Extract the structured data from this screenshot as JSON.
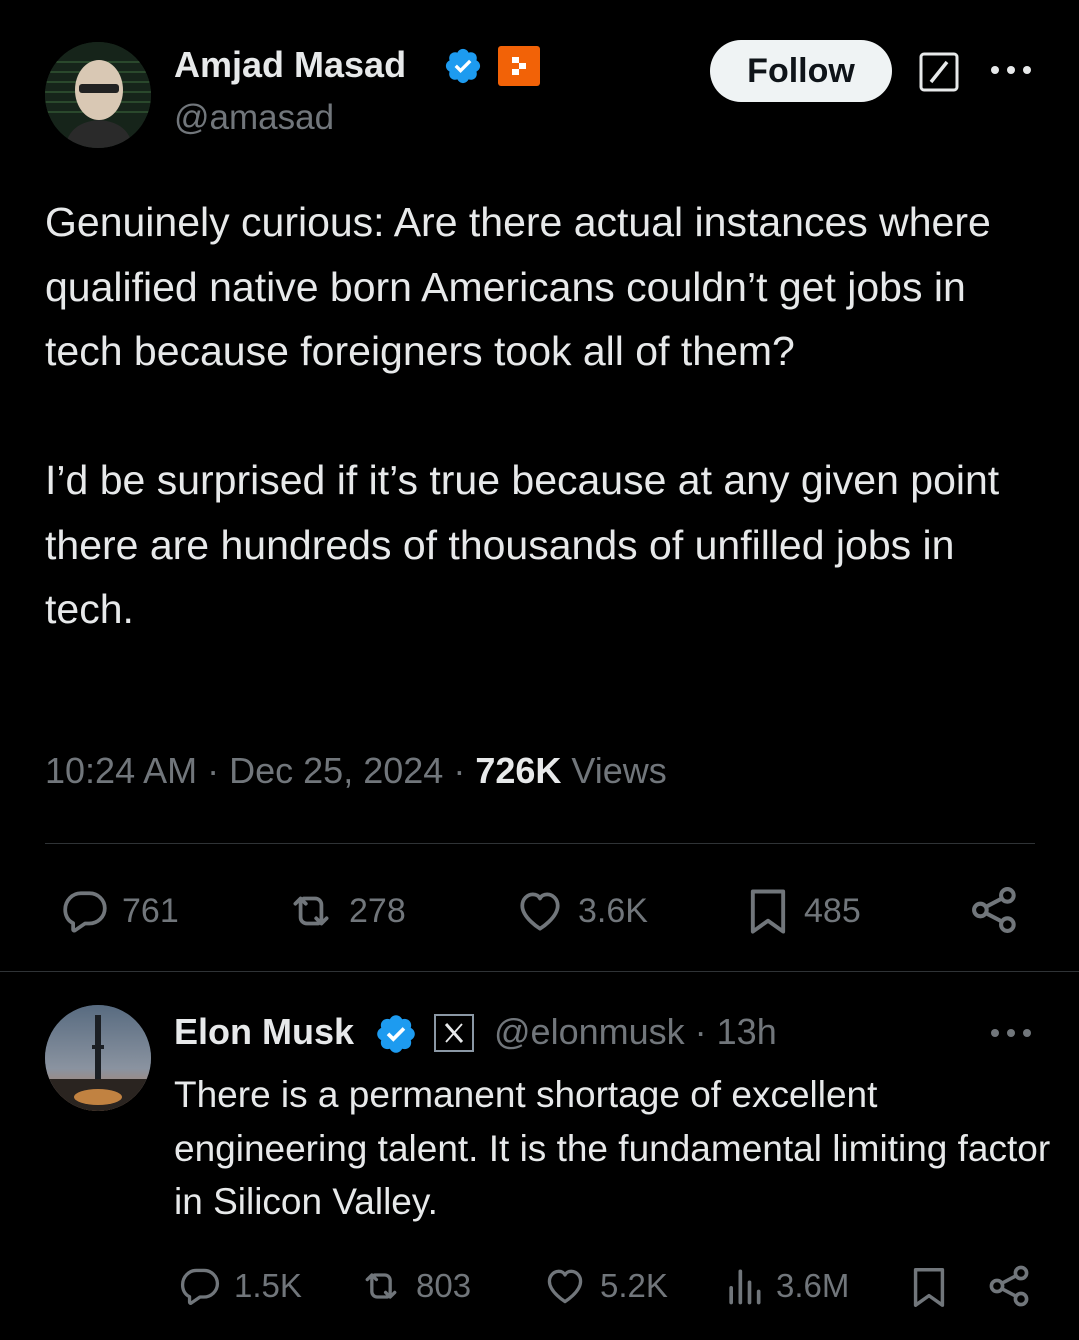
{
  "tweet": {
    "author_name": "Amjad Masad",
    "author_handle": "@amasad",
    "follow_label": "Follow",
    "paragraphs": [
      "Genuinely curious: Are there actual instances where qualified native born Americans couldn’t get jobs in tech because foreigners took all of them?",
      "I’d be surprised if it’s true because at any given point there are hundreds of thousands of unfilled jobs in tech."
    ],
    "time": "10:24 AM",
    "date": "Dec 25, 2024",
    "views_count": "726K",
    "views_label": "Views",
    "separator": "·",
    "stats": {
      "replies": "761",
      "reposts": "278",
      "likes": "3.6K",
      "bookmarks": "485"
    },
    "colors": {
      "verified": "#1d9bf0",
      "affiliate_badge": "#f26207"
    }
  },
  "reply": {
    "author_name": "Elon Musk",
    "author_handle": "@elonmusk",
    "separator": "·",
    "time_ago": "13h",
    "text": "There is a permanent shortage of excellent engineering talent. It is the fundamental limiting factor in Silicon Valley.",
    "stats": {
      "replies": "1.5K",
      "reposts": "803",
      "likes": "5.2K",
      "views": "3.6M"
    }
  },
  "icons": {
    "verified": "verified-badge-icon",
    "affiliate": "replit-logo-icon",
    "grok": "grok-icon",
    "more": "more-options-icon",
    "reply": "reply-icon",
    "repost": "repost-icon",
    "like": "heart-icon",
    "bookmark": "bookmark-icon",
    "share": "share-icon",
    "views": "views-icon",
    "x_affiliate": "x-logo-icon"
  }
}
